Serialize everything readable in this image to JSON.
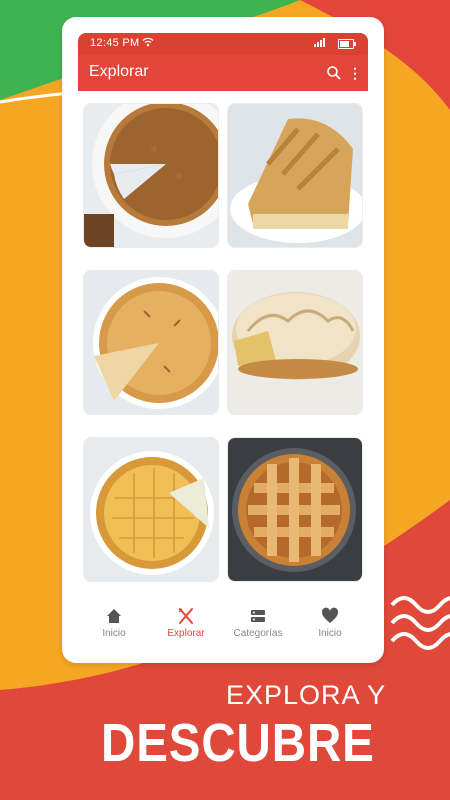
{
  "status_bar": {
    "time": "12:45 PM"
  },
  "app_bar": {
    "title": "Explorar"
  },
  "recipes": [
    {
      "name": "pie-1"
    },
    {
      "name": "pie-2"
    },
    {
      "name": "pie-3"
    },
    {
      "name": "pie-4"
    },
    {
      "name": "pie-5"
    },
    {
      "name": "pie-6"
    }
  ],
  "bottom_nav": {
    "items": [
      {
        "label": "Inicio",
        "icon": "home-icon",
        "active": false
      },
      {
        "label": "Explorar",
        "icon": "fork-knife-icon",
        "active": true
      },
      {
        "label": "Categorías",
        "icon": "categories-icon",
        "active": false
      },
      {
        "label": "Inicio",
        "icon": "heart-icon",
        "active": false
      }
    ]
  },
  "promo": {
    "line1": "EXPLORA Y",
    "line2": "DESCUBRE"
  },
  "colors": {
    "primary": "#e2463b",
    "status_bar": "#d94131",
    "background_orange": "#f5a623",
    "background_red": "#e0493a",
    "background_green": "#3fb34f"
  }
}
